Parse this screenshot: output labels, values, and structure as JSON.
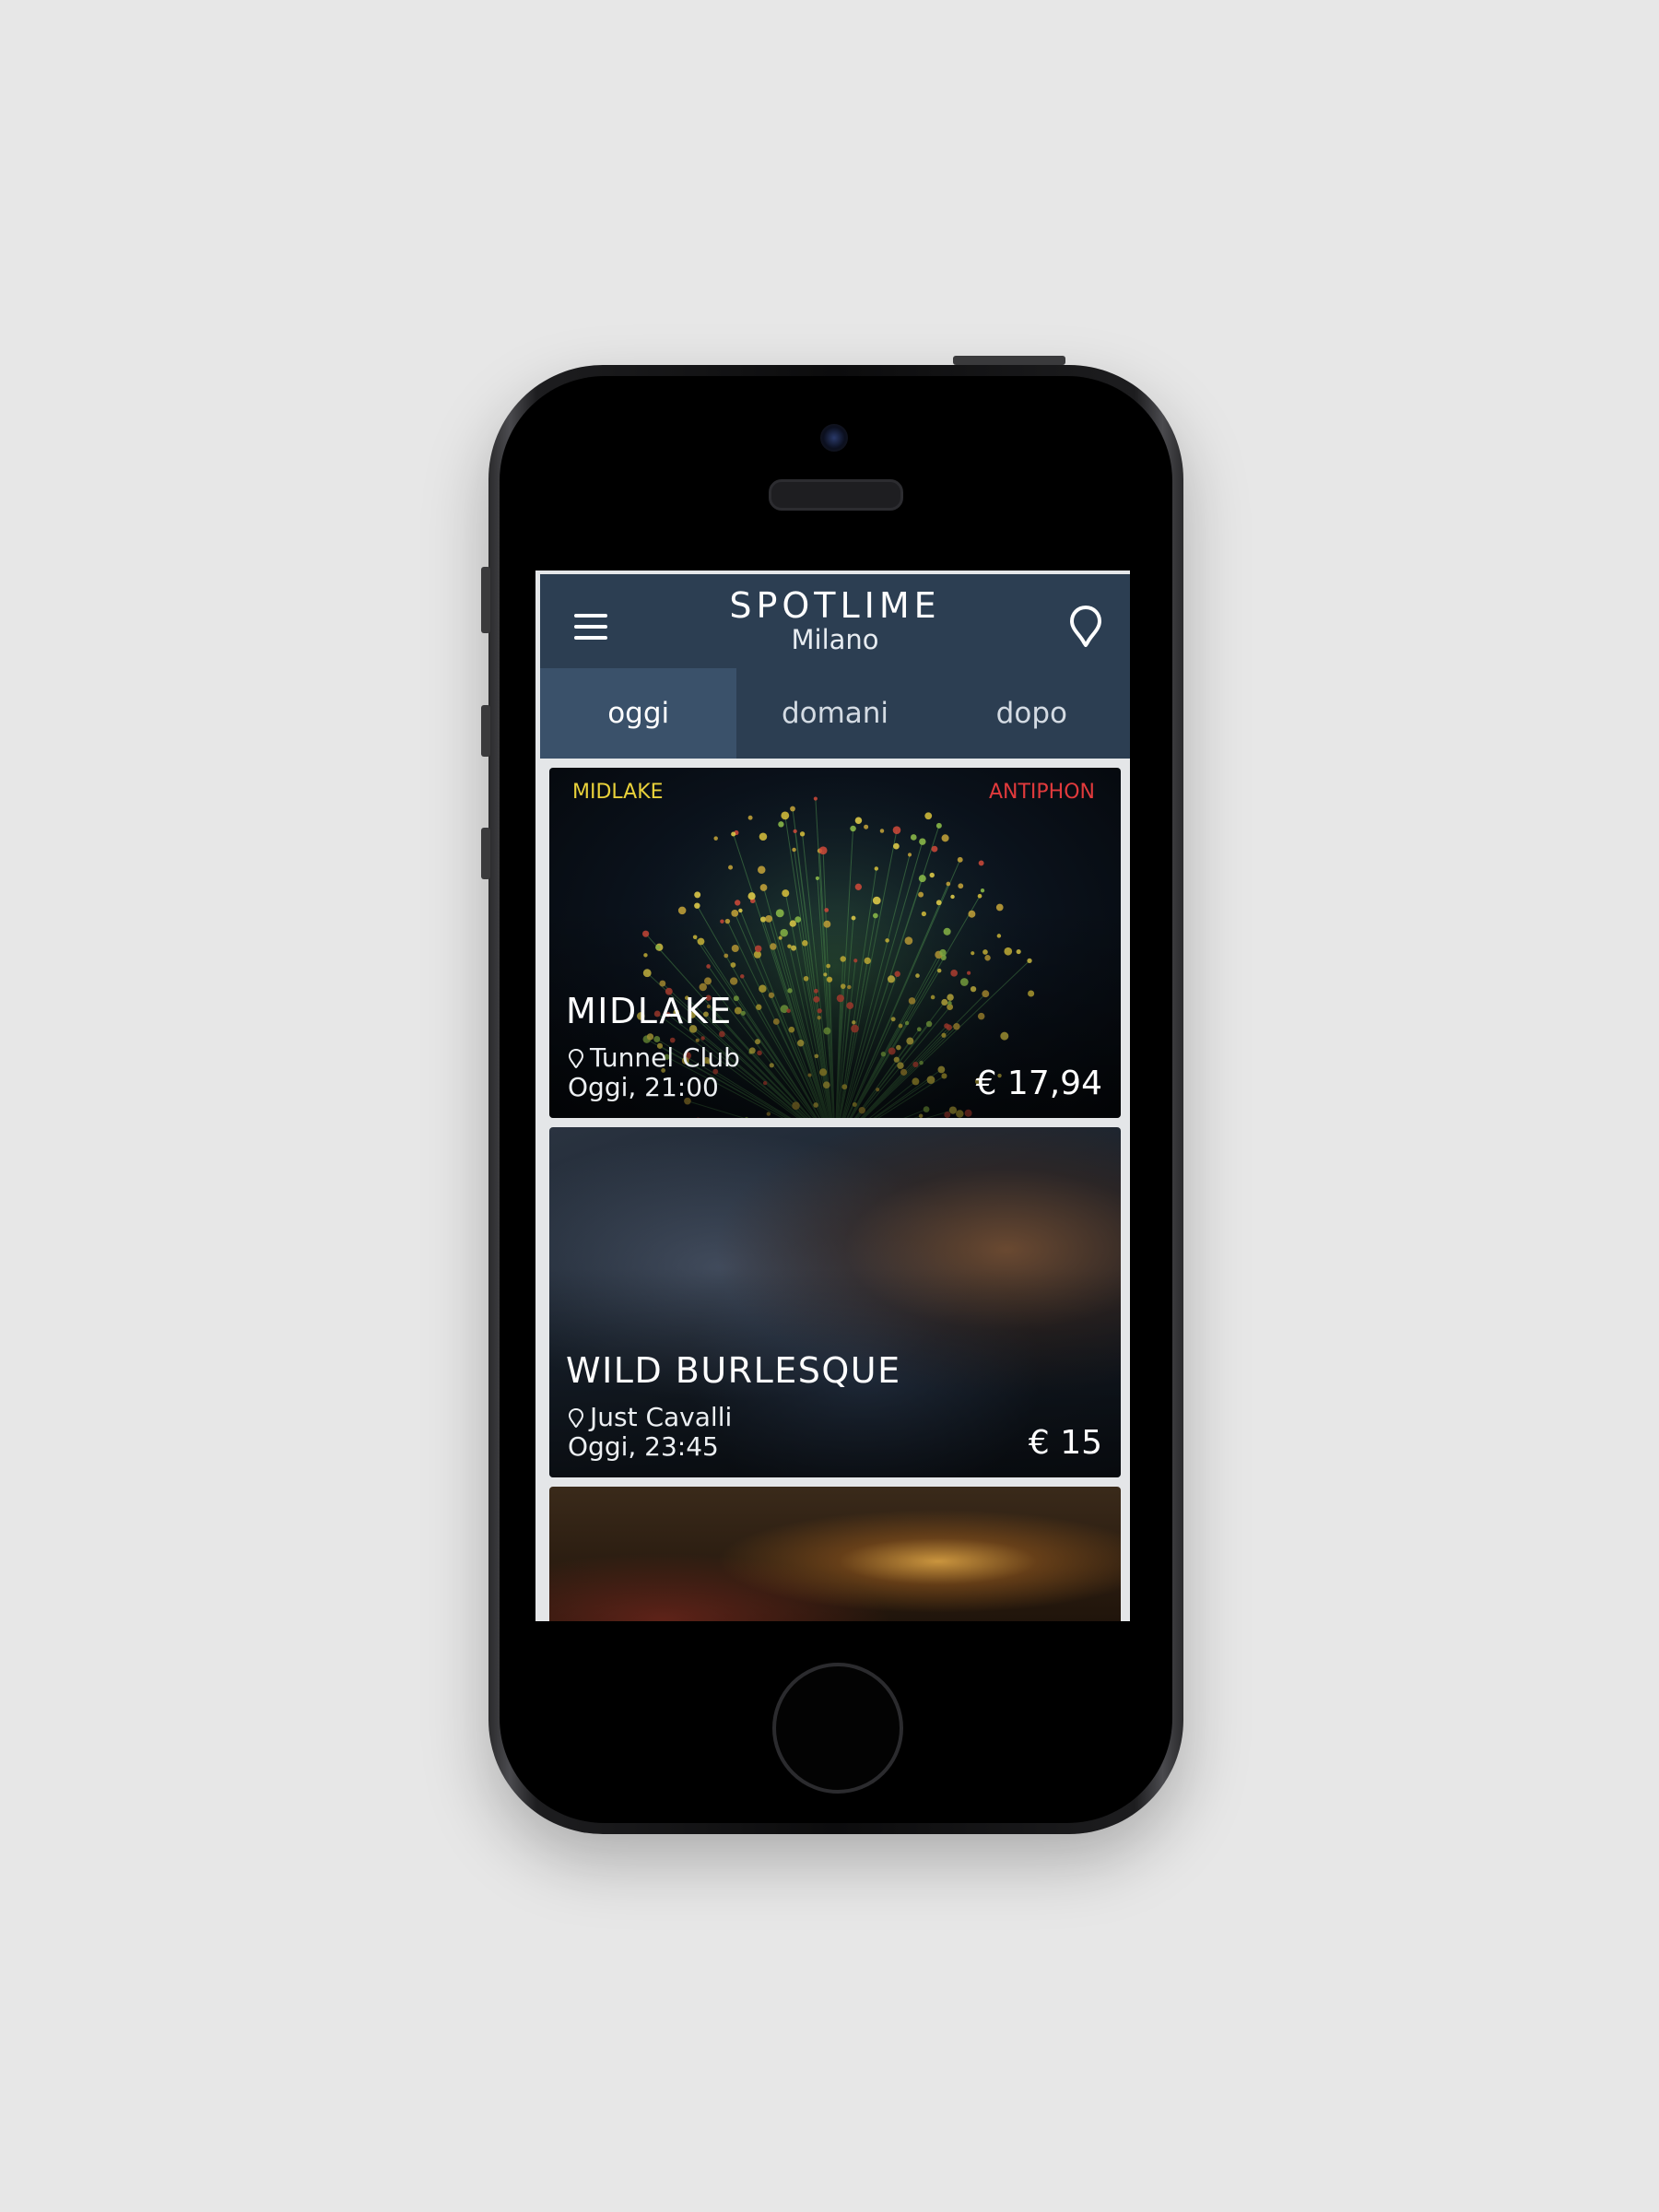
{
  "app": {
    "brand": "SPOTLIME",
    "city": "Milano"
  },
  "tabs": [
    {
      "label": "oggi",
      "active": true
    },
    {
      "label": "domani",
      "active": false
    },
    {
      "label": "dopo",
      "active": false
    }
  ],
  "events": [
    {
      "artists_left": "MIDLAKE",
      "artists_right": "ANTIPHON",
      "title": "MIDLAKE",
      "venue": "Tunnel Club",
      "time": "Oggi, 21:00",
      "price": "€ 17,94"
    },
    {
      "title": "WILD BURLESQUE",
      "venue": "Just Cavalli",
      "time": "Oggi, 23:45",
      "price": "€ 15"
    }
  ],
  "icons": {
    "menu": "hamburger-menu-icon",
    "location": "map-pin-icon",
    "venue": "map-pin-icon"
  },
  "colors": {
    "header": "#2c3e52",
    "active_tab": "#3a516a",
    "artist_left": "#e9d13a",
    "artist_right": "#e13a3c"
  }
}
